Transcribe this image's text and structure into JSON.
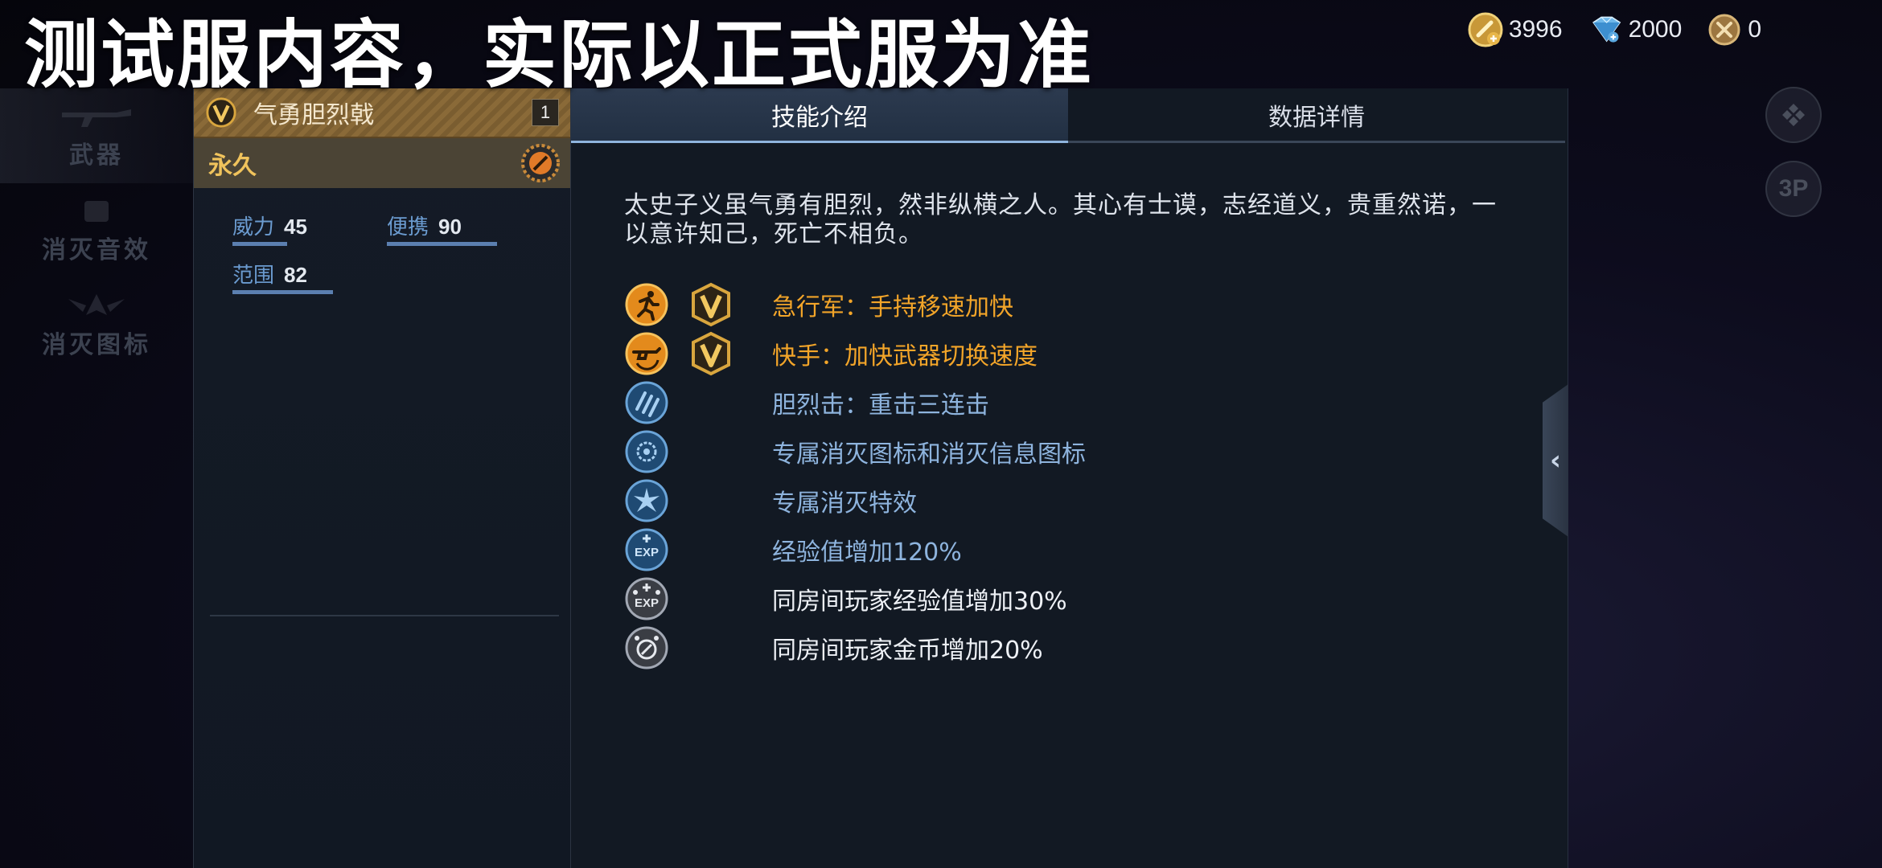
{
  "banner": "测试服内容，实际以正式服为准",
  "currency": [
    {
      "icon": "gold-coin-icon",
      "value": "3996"
    },
    {
      "icon": "diamond-icon",
      "value": "2000"
    },
    {
      "icon": "voucher-coin-icon",
      "value": "0"
    }
  ],
  "left_nav": [
    {
      "label": "武器"
    },
    {
      "label": "消灭音效"
    },
    {
      "label": "消灭图标"
    }
  ],
  "right_buttons": {
    "third_person": "3P"
  },
  "item": {
    "name": "气勇胆烈戟",
    "count": "1",
    "duration": "永久",
    "stats": [
      {
        "label": "威力",
        "value": "45",
        "level": 0.45
      },
      {
        "label": "便携",
        "value": "90",
        "level": 0.9
      },
      {
        "label": "范围",
        "value": "82",
        "level": 0.82
      }
    ]
  },
  "tabs": [
    {
      "label": "技能介绍",
      "active": true
    },
    {
      "label": "数据详情",
      "active": false
    }
  ],
  "description": "太史子义虽气勇有胆烈，然非纵横之人。其心有士谟，志经道义，贵重然诺，一以意许知己，死亡不相负。",
  "skills": [
    {
      "icon": "sprint-icon",
      "vip": true,
      "text": "急行军：手持移速加快",
      "color": "orange"
    },
    {
      "icon": "weapon-swap-icon",
      "vip": true,
      "text": "快手：加快武器切换速度",
      "color": "orange"
    },
    {
      "icon": "triple-strike-icon",
      "vip": false,
      "text": "胆烈击：重击三连击",
      "color": "blue"
    },
    {
      "icon": "kill-icon-badge-icon",
      "vip": false,
      "text": "专属消灭图标和消灭信息图标",
      "color": "blue"
    },
    {
      "icon": "kill-effect-icon",
      "vip": false,
      "text": "专属消灭特效",
      "color": "blue"
    },
    {
      "icon": "exp-boost-icon",
      "vip": false,
      "text": "经验值增加120%",
      "color": "blue"
    },
    {
      "icon": "room-exp-icon",
      "vip": false,
      "text": "同房间玩家经验值增加30%",
      "color": "white"
    },
    {
      "icon": "room-coin-icon",
      "vip": false,
      "text": "同房间玩家金币增加20%",
      "color": "white"
    }
  ],
  "colors": {
    "accent_orange": "#f3a529",
    "accent_blue": "#8eb4de",
    "vip_gold": "#d9a63e"
  }
}
